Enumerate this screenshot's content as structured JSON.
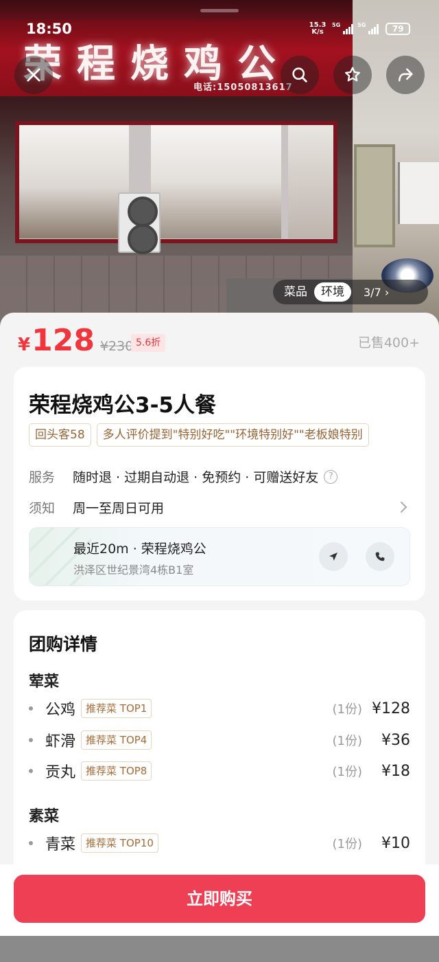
{
  "status_bar": {
    "time": "18:50",
    "net_speed_value": "15.3",
    "net_speed_unit": "K/s",
    "signal_1": "5G",
    "signal_2": "5G",
    "battery": "79"
  },
  "hero": {
    "sign_text": "荣程烧鸡公",
    "sign_phone": "电话:15050813617",
    "tabs": [
      "菜品",
      "环境"
    ],
    "active_tab": "环境",
    "counter": "3/7 ›"
  },
  "price": {
    "currency": "¥",
    "current": "128",
    "original": "¥230",
    "discount": "5.6折",
    "sold": "已售400+"
  },
  "deal": {
    "title": "荣程烧鸡公3-5人餐",
    "tags": [
      "回头客58",
      "多人评价提到\"特别好吃\"\"环境特别好\"\"老板娘特别"
    ],
    "service_label": "服务",
    "service_value": "随时退 · 过期自动退 · 免预约 · 可赠送好友",
    "notice_label": "须知",
    "notice_value": "周一至周日可用",
    "address_title": "最近20m · 荣程烧鸡公",
    "address_sub": "洪泽区世纪景湾4栋B1室"
  },
  "details": {
    "title": "团购详情",
    "groups": [
      {
        "name": "荤菜",
        "items": [
          {
            "name": "公鸡",
            "tag": "推荐菜 TOP1",
            "qty": "(1份)",
            "price": "¥128"
          },
          {
            "name": "虾滑",
            "tag": "推荐菜 TOP4",
            "qty": "(1份)",
            "price": "¥36"
          },
          {
            "name": "贡丸",
            "tag": "推荐菜 TOP8",
            "qty": "(1份)",
            "price": "¥18"
          }
        ]
      },
      {
        "name": "素菜",
        "items": [
          {
            "name": "青菜",
            "tag": "推荐菜 TOP10",
            "qty": "(1份)",
            "price": "¥10"
          }
        ]
      }
    ]
  },
  "buy_button": "立即购买",
  "colors": {
    "accent": "#f0353c",
    "buy": "#ee3f55",
    "tag_text": "#9a6434"
  }
}
